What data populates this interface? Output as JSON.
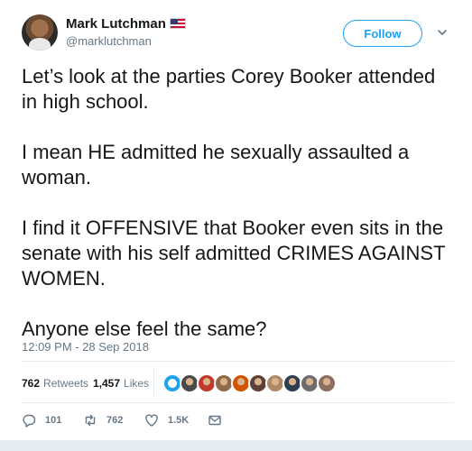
{
  "author": {
    "display_name": "Mark Lutchman",
    "handle": "@marklutchman",
    "badge_icon": "us-flag-icon"
  },
  "follow_label": "Follow",
  "tweet": {
    "paragraphs": [
      "Let’s look at the parties Corey Booker attended in high school.",
      "I mean HE admitted he sexually assaulted a woman.",
      "I find it OFFENSIVE that Booker even sits in the senate with his self admitted CRIMES AGAINST WOMEN.",
      "Anyone else feel the same?"
    ],
    "timestamp": "12:09 PM - 28 Sep 2018"
  },
  "stats": {
    "retweets_count": "762",
    "retweets_label": "Retweets",
    "likes_count": "1,457",
    "likes_label": "Likes"
  },
  "liker_avatar_colors": [
    "#1da1f2",
    "#4a4a4a",
    "#c0392b",
    "#8e6b4b",
    "#d35400",
    "#5d4037",
    "#b08968",
    "#2c3e50",
    "#6d6d6d",
    "#8d6e63"
  ],
  "actions": {
    "reply_count": "101",
    "retweet_count": "762",
    "like_count": "1.5K"
  },
  "colors": {
    "accent": "#1da1f2",
    "muted": "#657786",
    "text": "#14171a"
  }
}
